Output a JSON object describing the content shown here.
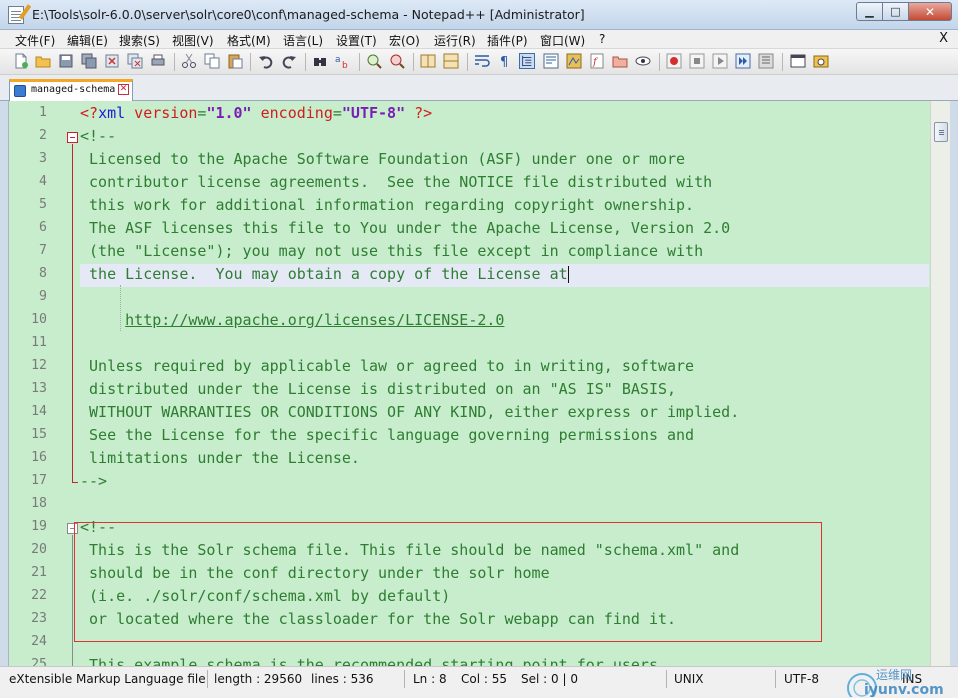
{
  "window": {
    "title": "E:\\Tools\\solr-6.0.0\\server\\solr\\core0\\conf\\managed-schema - Notepad++ [Administrator]",
    "controls": {
      "minimize": "▁",
      "maximize": "□",
      "close": "✕"
    }
  },
  "menu": {
    "items": [
      "文件(F)",
      "编辑(E)",
      "搜索(S)",
      "视图(V)",
      "格式(M)",
      "语言(L)",
      "设置(T)",
      "宏(O)",
      "运行(R)",
      "插件(P)",
      "窗口(W)",
      "?"
    ],
    "close_label": "X"
  },
  "toolbar": {
    "icons": [
      "new-file-icon",
      "open-file-icon",
      "save-icon",
      "save-all-icon",
      "close-icon",
      "close-all-icon",
      "print-icon",
      "cut-icon",
      "copy-icon",
      "paste-icon",
      "undo-icon",
      "redo-icon",
      "find-icon",
      "replace-icon",
      "zoom-in-icon",
      "zoom-out-icon",
      "sync-v-icon",
      "sync-h-icon",
      "word-wrap-icon",
      "show-all-chars-icon",
      "indent-guide-icon",
      "user-lang-icon",
      "doc-map-icon",
      "function-list-icon",
      "folder-icon",
      "monitor-icon",
      "record-macro-icon",
      "stop-record-icon",
      "play-macro-icon",
      "run-multiple-icon",
      "save-macro-icon",
      "console-icon",
      "launch-icon"
    ],
    "colors": {
      "accent": "#3a6ea5",
      "record": "#d32f2f"
    }
  },
  "tab": {
    "label": "managed-schema"
  },
  "editor": {
    "current_line": 8,
    "lines": [
      {
        "n": "1",
        "parts": [
          {
            "t": "<?",
            "c": "xml-tag"
          },
          {
            "t": "xml",
            "c": "xml-name"
          },
          {
            "t": " version",
            "c": "xml-attr"
          },
          {
            "t": "=",
            "c": "plain"
          },
          {
            "t": "\"1.0\"",
            "c": "xml-val"
          },
          {
            "t": " encoding",
            "c": "xml-attr"
          },
          {
            "t": "=",
            "c": "plain"
          },
          {
            "t": "\"UTF-8\"",
            "c": "xml-val"
          },
          {
            "t": " ?>",
            "c": "xml-tag"
          }
        ]
      },
      {
        "n": "2",
        "text": "<!--"
      },
      {
        "n": "3",
        "text": " Licensed to the Apache Software Foundation (ASF) under one or more"
      },
      {
        "n": "4",
        "text": " contributor license agreements.  See the NOTICE file distributed with"
      },
      {
        "n": "5",
        "text": " this work for additional information regarding copyright ownership."
      },
      {
        "n": "6",
        "text": " The ASF licenses this file to You under the Apache License, Version 2.0"
      },
      {
        "n": "7",
        "text": " (the \"License\"); you may not use this file except in compliance with"
      },
      {
        "n": "8",
        "text": " the License.  You may obtain a copy of the License at"
      },
      {
        "n": "9",
        "text": ""
      },
      {
        "n": "10",
        "text": "     ",
        "link": "http://www.apache.org/licenses/LICENSE-2.0"
      },
      {
        "n": "11",
        "text": ""
      },
      {
        "n": "12",
        "text": " Unless required by applicable law or agreed to in writing, software"
      },
      {
        "n": "13",
        "text": " distributed under the License is distributed on an \"AS IS\" BASIS,"
      },
      {
        "n": "14",
        "text": " WITHOUT WARRANTIES OR CONDITIONS OF ANY KIND, either express or implied."
      },
      {
        "n": "15",
        "text": " See the License for the specific language governing permissions and"
      },
      {
        "n": "16",
        "text": " limitations under the License."
      },
      {
        "n": "17",
        "text": "-->"
      },
      {
        "n": "18",
        "text": ""
      },
      {
        "n": "19",
        "text": "<!--"
      },
      {
        "n": "20",
        "text": " This is the Solr schema file. This file should be named \"schema.xml\" and"
      },
      {
        "n": "21",
        "text": " should be in the conf directory under the solr home"
      },
      {
        "n": "22",
        "text": " (i.e. ./solr/conf/schema.xml by default)"
      },
      {
        "n": "23",
        "text": " or located where the classloader for the Solr webapp can find it."
      },
      {
        "n": "24",
        "text": ""
      },
      {
        "n": "25",
        "text": " This example schema is the recommended starting point for users."
      }
    ]
  },
  "status": {
    "language": "eXtensible Markup Language file",
    "length": "length : 29560",
    "lines": "lines : 536",
    "ln": "Ln : 8",
    "col": "Col : 55",
    "sel": "Sel : 0 | 0",
    "eol": "UNIX",
    "encoding": "UTF-8",
    "mode": "INS",
    "watermark_top": "运维网",
    "watermark_bottom": "iyunv.com"
  }
}
